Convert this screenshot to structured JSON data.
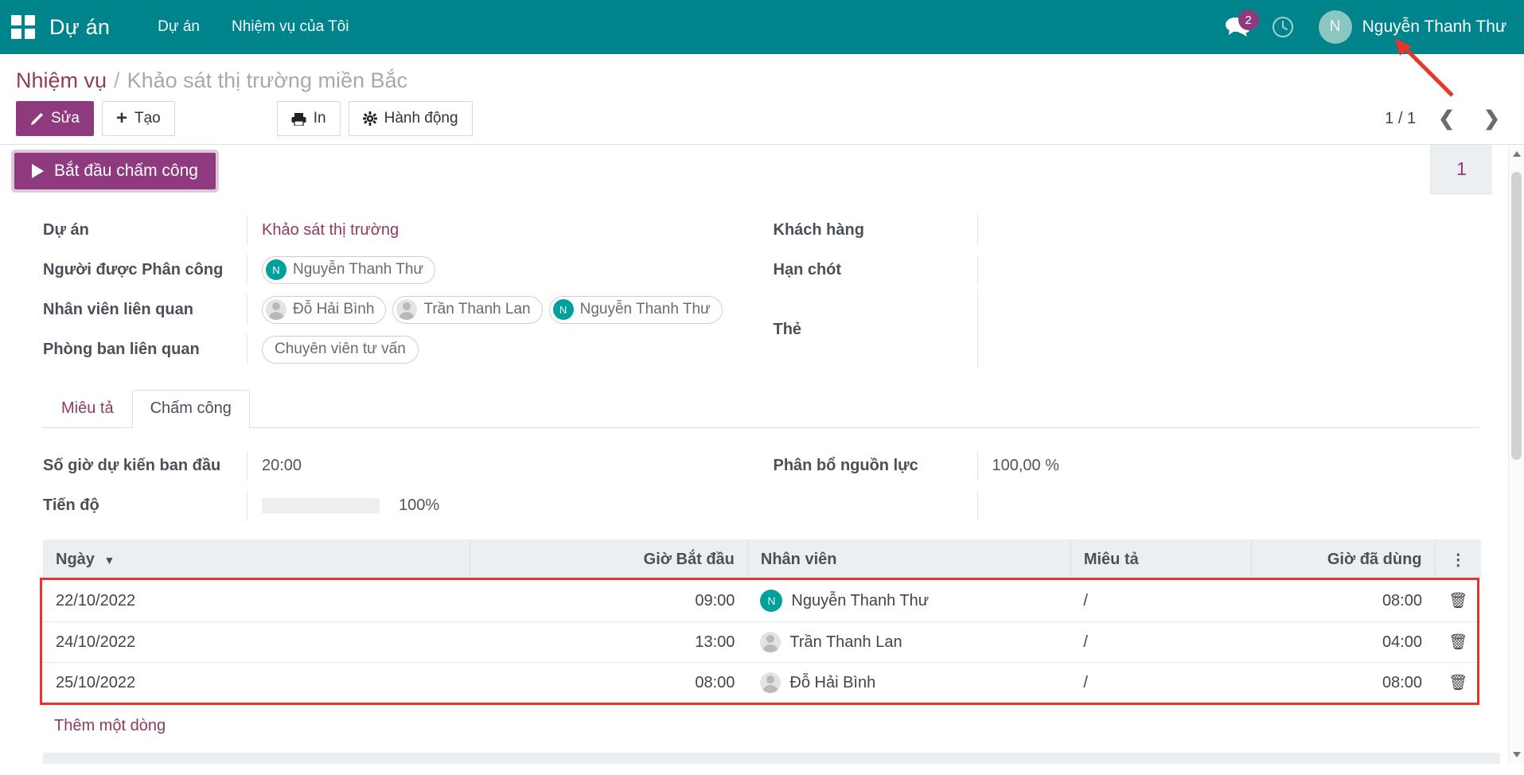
{
  "navbar": {
    "apps_icon": "apps-grid-icon",
    "brand": "Dự án",
    "menu": [
      {
        "label": "Dự án"
      },
      {
        "label": "Nhiệm vụ của Tôi"
      }
    ],
    "messages_icon": "chat-bubbles-icon",
    "messages_count": "2",
    "activities_icon": "clock-icon",
    "user_initial": "N",
    "user_name": "Nguyễn Thanh Thư",
    "background_color": "#00848c"
  },
  "breadcrumb": {
    "root": "Nhiệm vụ",
    "separator": "/",
    "current": "Khảo sát thị trường miền Bắc"
  },
  "control_panel": {
    "edit_label": "Sửa",
    "edit_icon": "pencil-icon",
    "create_label": "Tạo",
    "create_icon": "plus-icon",
    "print_label": "In",
    "print_icon": "printer-icon",
    "action_label": "Hành động",
    "action_icon": "gear-icon",
    "pager_count": "1 / 1",
    "pager_prev_icon": "chevron-left-icon",
    "pager_next_icon": "chevron-right-icon"
  },
  "sheet": {
    "start_timer_label": "Bắt đầu chấm công",
    "start_timer_icon": "play-icon",
    "stat_button_value": "1"
  },
  "form": {
    "left": [
      {
        "label": "Dự án",
        "value": "Khảo sát thị trường",
        "type": "link"
      },
      {
        "label": "Người được Phân công",
        "type": "tags",
        "tags": [
          {
            "text": "Nguyễn Thanh Thư",
            "avatar": "N",
            "avatar_style": "green"
          }
        ]
      },
      {
        "label": "Nhân viên liên quan",
        "type": "tags",
        "tags": [
          {
            "text": "Đỗ Hải Bình",
            "avatar": "",
            "avatar_style": "silhouette"
          },
          {
            "text": "Trần Thanh Lan",
            "avatar": "",
            "avatar_style": "silhouette"
          },
          {
            "text": "Nguyễn Thanh Thư",
            "avatar": "N",
            "avatar_style": "green"
          }
        ]
      },
      {
        "label": "Phòng ban liên quan",
        "type": "tags",
        "tags": [
          {
            "text": "Chuyên viên tư vấn",
            "avatar": "",
            "avatar_style": "none"
          }
        ]
      }
    ],
    "right": [
      {
        "label": "Khách hàng",
        "value": ""
      },
      {
        "label": "Hạn chót",
        "value": ""
      },
      {
        "label": "Thẻ",
        "value": ""
      }
    ]
  },
  "notebook": {
    "tabs": [
      {
        "label": "Miêu tả",
        "active": false
      },
      {
        "label": "Chấm công",
        "active": true
      }
    ]
  },
  "timesheet_panel": {
    "initial_hours_label": "Số giờ dự kiến ban đầu",
    "initial_hours_value": "20:00",
    "progress_label": "Tiến độ",
    "progress_value": "100%",
    "progress_percent": 100,
    "allocation_label": "Phân bổ nguồn lực",
    "allocation_value": "100,00 %"
  },
  "table": {
    "columns": [
      {
        "label": "Ngày",
        "sort_icon": "caret-down-icon",
        "align": "left"
      },
      {
        "label": "Giờ Bắt đầu",
        "align": "right"
      },
      {
        "label": "Nhân viên",
        "align": "left"
      },
      {
        "label": "Miêu tả",
        "align": "left"
      },
      {
        "label": "Giờ đã dùng",
        "align": "right"
      }
    ],
    "options_icon": "kebab-menu-icon",
    "rows": [
      {
        "date": "22/10/2022",
        "start": "09:00",
        "employee": "Nguyễn Thanh Thư",
        "avatar": "N",
        "avatar_style": "green",
        "description": "/",
        "hours": "08:00",
        "delete_icon": "trash-icon"
      },
      {
        "date": "24/10/2022",
        "start": "13:00",
        "employee": "Trần Thanh Lan",
        "avatar": "",
        "avatar_style": "silhouette",
        "description": "/",
        "hours": "04:00",
        "delete_icon": "trash-icon"
      },
      {
        "date": "25/10/2022",
        "start": "08:00",
        "employee": "Đỗ Hải Bình",
        "avatar": "",
        "avatar_style": "silhouette",
        "description": "/",
        "hours": "08:00",
        "delete_icon": "trash-icon"
      }
    ],
    "add_line_label": "Thêm một dòng"
  },
  "annotations": {
    "arrow_color": "#e8352a",
    "highlight_color": "#e8352a"
  }
}
